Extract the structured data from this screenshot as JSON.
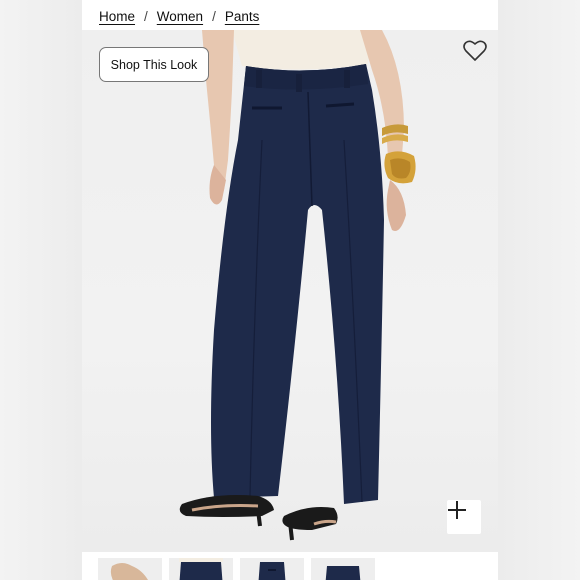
{
  "breadcrumb": {
    "items": [
      {
        "label": "Home"
      },
      {
        "label": "Women"
      },
      {
        "label": "Pants"
      }
    ],
    "separator": "/"
  },
  "hero": {
    "shop_look_label": "Shop This Look",
    "wishlist_icon": "heart-outline-icon",
    "zoom_icon": "plus-icon"
  },
  "thumbnails": [
    {
      "icon": "thumbnail-sandal"
    },
    {
      "icon": "thumbnail-pants-front"
    },
    {
      "icon": "thumbnail-pants-back"
    },
    {
      "icon": "thumbnail-pants-detail"
    }
  ],
  "colors": {
    "pants": "#1e2a4a",
    "background": "#efefef",
    "text": "#111111"
  }
}
